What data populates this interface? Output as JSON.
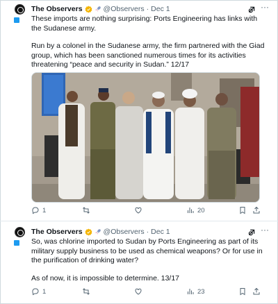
{
  "tweets": [
    {
      "author_name": "The Observers",
      "handle": "@Observers",
      "separator": "·",
      "date": "Dec 1",
      "paragraph1": "These imports are nothing surprising: Ports Engineering has links with the Sudanese army.",
      "paragraph2": "Run by a colonel in the Sudanese army, the firm partnered with the Giad group, which has been sanctioned numerous times for its activities threatening “peace and security in Sudan.” 12/17",
      "has_photo": true,
      "stats": {
        "replies": "1",
        "retweets": "",
        "likes": "",
        "views": "20"
      }
    },
    {
      "author_name": "The Observers",
      "handle": "@Observers",
      "separator": "·",
      "date": "Dec 1",
      "paragraph1": "So, was chlorine imported to Sudan by Ports Engineering as part of its military supply business to be used as chemical weapons? Or for use in the purification of drinking water?",
      "paragraph2": "As of now, it is impossible to determine. 13/17",
      "has_photo": false,
      "stats": {
        "replies": "1",
        "retweets": "",
        "likes": "",
        "views": "23"
      }
    }
  ],
  "colors": {
    "verified": "#f4b400",
    "accent": "#1d9bf0",
    "muted": "#536471",
    "text": "#0f1419"
  },
  "icons": [
    "logo-avatar-icon",
    "verified-badge-icon",
    "rocket-emoji-icon",
    "grok-icon",
    "more-icon",
    "reply-icon",
    "retweet-icon",
    "like-icon",
    "views-icon",
    "bookmark-icon",
    "share-icon"
  ]
}
